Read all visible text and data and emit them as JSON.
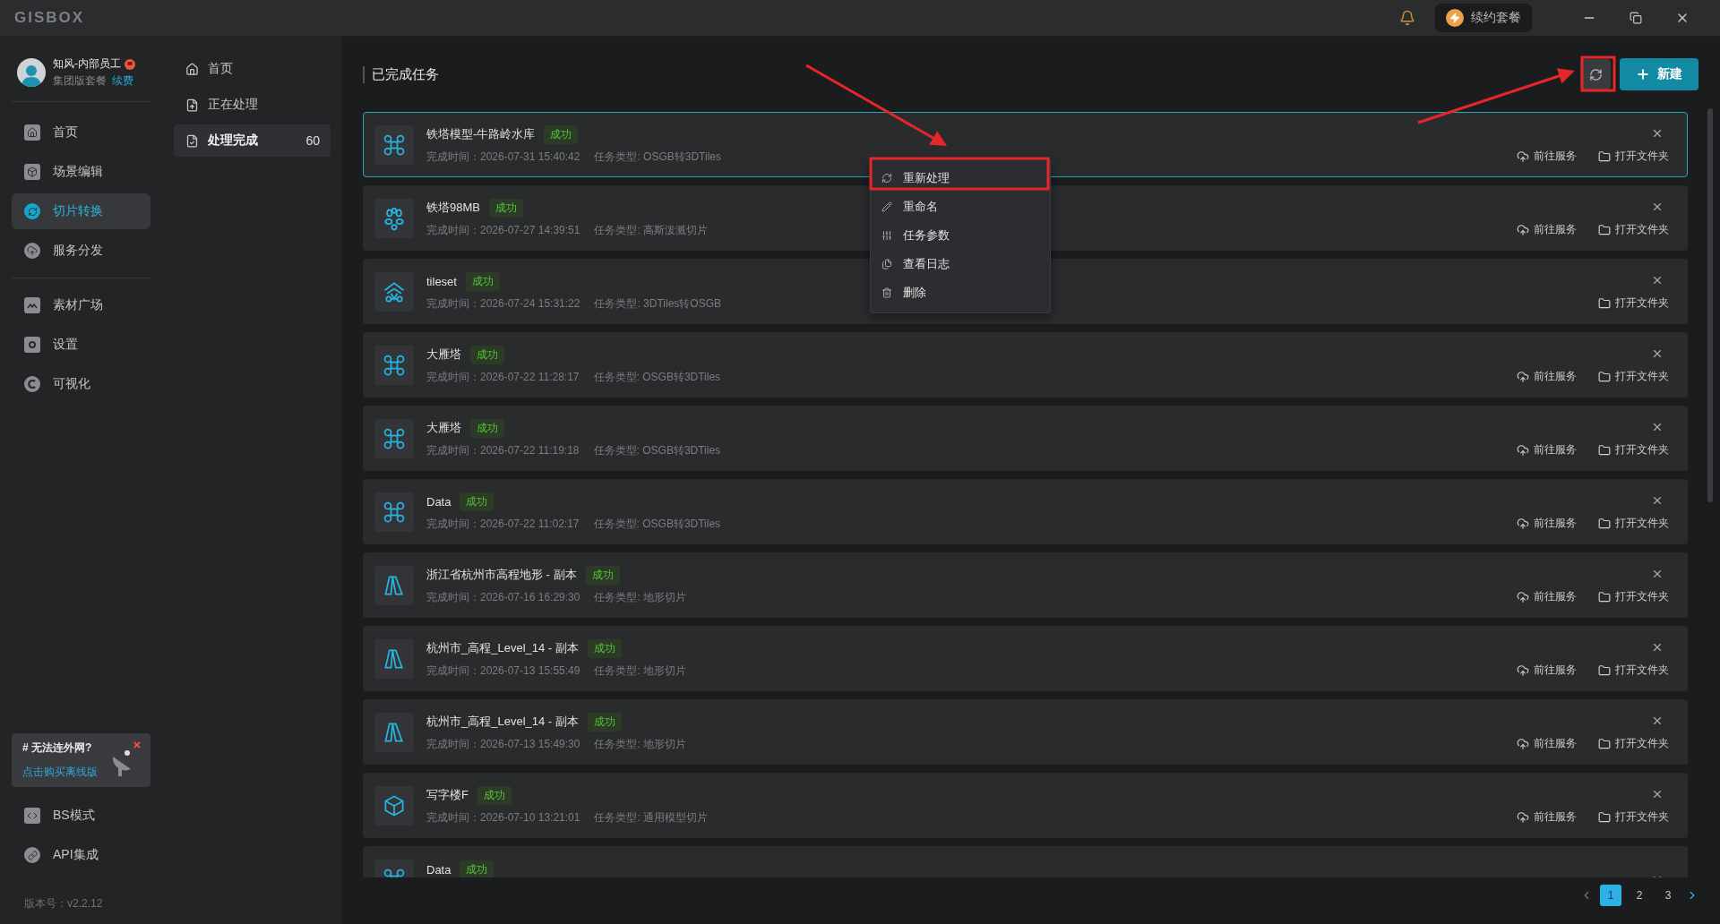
{
  "app": {
    "logo": "GISBOX",
    "renew_button": "续约套餐"
  },
  "user": {
    "name": "知风-内部员工",
    "plan": "集团版套餐",
    "renew_link": "续费"
  },
  "nav": [
    {
      "kind": "home",
      "label": "首页",
      "selected": false
    },
    {
      "kind": "scene",
      "label": "场景编辑",
      "selected": false
    },
    {
      "kind": "convert",
      "label": "切片转换",
      "selected": true
    },
    {
      "kind": "publish",
      "label": "服务分发",
      "selected": false
    },
    {
      "kind": "divider"
    },
    {
      "kind": "assets",
      "label": "素材广场",
      "selected": false
    },
    {
      "kind": "settings",
      "label": "设置",
      "selected": false
    },
    {
      "kind": "visual",
      "label": "可视化",
      "selected": false
    }
  ],
  "promo": {
    "title": "# 无法连外网?",
    "link": "点击购买离线版"
  },
  "bottom_nav": [
    {
      "kind": "code",
      "label": "BS模式"
    },
    {
      "kind": "api",
      "label": "API集成"
    }
  ],
  "version": "版本号：v2.2.12",
  "subnav": [
    {
      "kind": "home",
      "label": "首页",
      "selected": false
    },
    {
      "kind": "processing",
      "label": "正在处理",
      "selected": false
    },
    {
      "kind": "done",
      "label": "处理完成",
      "count": "60",
      "selected": true
    }
  ],
  "page_title": "已完成任务",
  "new_button": "新建",
  "tasks": [
    {
      "kind": "drone",
      "name": "铁塔模型-牛路岭水库",
      "status": "成功",
      "time": "完成时间：2026-07-31 15:40:42",
      "type": "任务类型: OSGB转3DTiles",
      "selected": true,
      "actions": [
        "前往服务",
        "打开文件夹"
      ]
    },
    {
      "kind": "gaussian",
      "name": "铁塔98MB",
      "status": "成功",
      "time": "完成时间：2026-07-27 14:39:51",
      "type": "任务类型: 高斯泼溅切片",
      "selected": false,
      "actions": [
        "前往服务",
        "打开文件夹"
      ]
    },
    {
      "kind": "tileset",
      "name": "tileset",
      "status": "成功",
      "time": "完成时间：2026-07-24 15:31:22",
      "type": "任务类型: 3DTiles转OSGB",
      "selected": false,
      "actions": [
        "打开文件夹"
      ]
    },
    {
      "kind": "drone",
      "name": "大雁塔",
      "status": "成功",
      "time": "完成时间：2026-07-22 11:28:17",
      "type": "任务类型: OSGB转3DTiles",
      "selected": false,
      "actions": [
        "前往服务",
        "打开文件夹"
      ]
    },
    {
      "kind": "drone",
      "name": "大雁塔",
      "status": "成功",
      "time": "完成时间：2026-07-22 11:19:18",
      "type": "任务类型: OSGB转3DTiles",
      "selected": false,
      "actions": [
        "前往服务",
        "打开文件夹"
      ]
    },
    {
      "kind": "drone",
      "name": "Data",
      "status": "成功",
      "time": "完成时间：2026-07-22 11:02:17",
      "type": "任务类型: OSGB转3DTiles",
      "selected": false,
      "actions": [
        "前往服务",
        "打开文件夹"
      ]
    },
    {
      "kind": "terrain",
      "name": "浙江省杭州市高程地形 - 副本",
      "status": "成功",
      "time": "完成时间：2026-07-16 16:29:30",
      "type": "任务类型: 地形切片",
      "selected": false,
      "actions": [
        "前往服务",
        "打开文件夹"
      ]
    },
    {
      "kind": "terrain",
      "name": "杭州市_高程_Level_14 - 副本",
      "status": "成功",
      "time": "完成时间：2026-07-13 15:55:49",
      "type": "任务类型: 地形切片",
      "selected": false,
      "actions": [
        "前往服务",
        "打开文件夹"
      ]
    },
    {
      "kind": "terrain",
      "name": "杭州市_高程_Level_14 - 副本",
      "status": "成功",
      "time": "完成时间：2026-07-13 15:49:30",
      "type": "任务类型: 地形切片",
      "selected": false,
      "actions": [
        "前往服务",
        "打开文件夹"
      ]
    },
    {
      "kind": "cube",
      "name": "写字楼F",
      "status": "成功",
      "time": "完成时间：2026-07-10 13:21:01",
      "type": "任务类型: 通用模型切片",
      "selected": false,
      "actions": [
        "前往服务",
        "打开文件夹"
      ]
    },
    {
      "kind": "drone",
      "name": "Data",
      "status": "成功",
      "selected": false
    }
  ],
  "context_menu": [
    {
      "kind": "reprocess",
      "label": "重新处理"
    },
    {
      "kind": "rename",
      "label": "重命名"
    },
    {
      "kind": "params",
      "label": "任务参数"
    },
    {
      "kind": "log",
      "label": "查看日志"
    },
    {
      "kind": "delete",
      "label": "删除"
    }
  ],
  "pagination": [
    {
      "label": "1",
      "selected": true
    },
    {
      "label": "2",
      "selected": false
    },
    {
      "label": "3",
      "selected": false
    }
  ]
}
